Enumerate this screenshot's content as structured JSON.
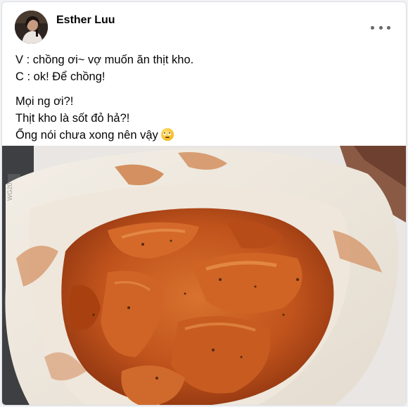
{
  "post": {
    "author": "Esther Luu",
    "lines_group1": [
      "V : chồng ơi~ vợ muốn ăn thịt kho.",
      "C : ok! Để chồng!"
    ],
    "lines_group2": [
      "Mọi ng ơi?!",
      "Thịt kho là sốt đỏ hả?!",
      "Ổng nói chưa xong nên vậy"
    ],
    "emoji": "rolling-eyes-emoji",
    "photo_side_text": "WG20"
  },
  "icons": {
    "more": "more-horizontal-icon"
  },
  "colors": {
    "text": "#050505",
    "muted": "#65676b",
    "sauce": "#c0531c"
  }
}
